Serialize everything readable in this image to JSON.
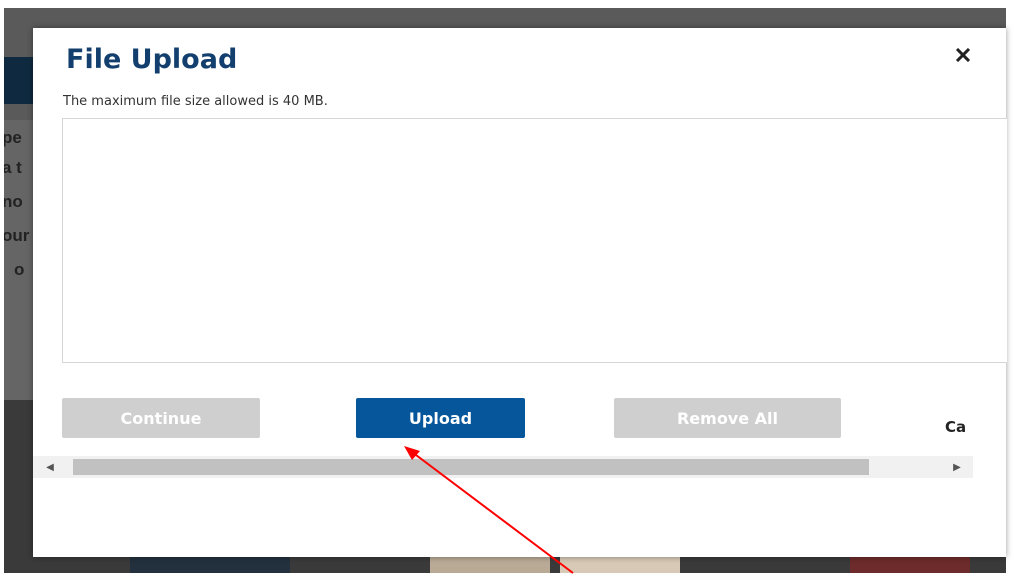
{
  "dialog": {
    "title": "File Upload",
    "size_note": "The maximum file size allowed is 40 MB.",
    "close_icon": "close-icon"
  },
  "buttons": {
    "continue_label": "Continue",
    "upload_label": "Upload",
    "remove_all_label": "Remove All",
    "cancel_label": "Ca"
  },
  "background_fragments": [
    "pe",
    "a t",
    "no",
    "our",
    "o"
  ],
  "colors": {
    "title": "#123f6d",
    "primary_button": "#06569b",
    "disabled_button": "#cfcfcf",
    "annotation_arrow": "#ff0000"
  }
}
